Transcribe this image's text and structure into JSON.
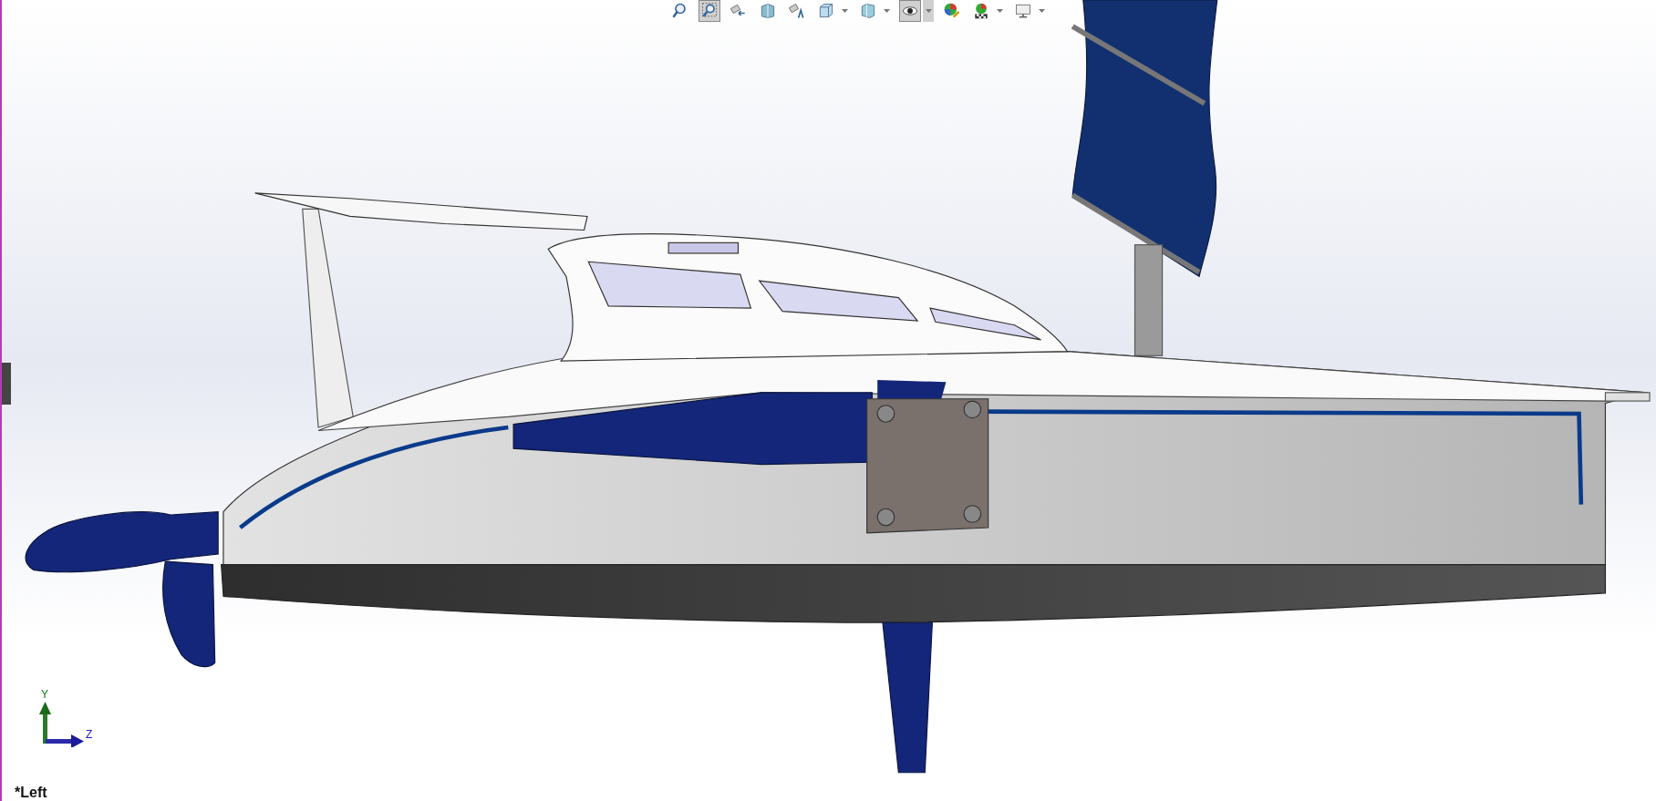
{
  "toolbar": [
    {
      "kind": "zoom-fit",
      "selected": false,
      "menu": false
    },
    {
      "kind": "zoom-area",
      "selected": true,
      "menu": false
    },
    {
      "kind": "previous-view",
      "selected": false,
      "menu": false
    },
    {
      "kind": "section",
      "selected": false,
      "menu": false
    },
    {
      "kind": "annotation",
      "selected": false,
      "menu": false
    },
    {
      "kind": "orientation",
      "selected": false,
      "menu": true
    },
    {
      "kind": "display-style",
      "selected": false,
      "menu": true
    },
    {
      "kind": "hide-show",
      "selected": true,
      "menu": true
    },
    {
      "kind": "appearance",
      "selected": false,
      "menu": false
    },
    {
      "kind": "scene",
      "selected": false,
      "menu": true
    },
    {
      "kind": "view-settings",
      "selected": false,
      "menu": true
    }
  ],
  "triad": {
    "y_label": "Y",
    "z_label": "Z"
  },
  "view_label": "*Left"
}
